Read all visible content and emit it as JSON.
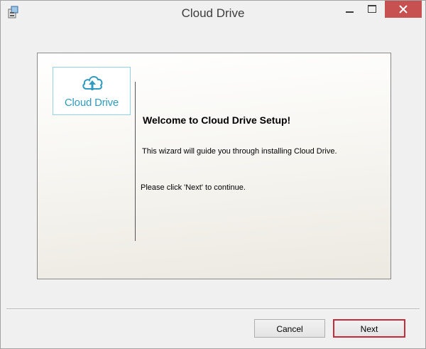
{
  "window": {
    "title": "Cloud Drive",
    "app_icon": "installer-icon"
  },
  "logo": {
    "icon": "cloud-upload-icon",
    "text": "Cloud Drive"
  },
  "wizard": {
    "heading": "Welcome to Cloud Drive Setup!",
    "description": "This wizard will guide you through installing Cloud Drive.",
    "instruction": "Please click 'Next' to continue."
  },
  "buttons": {
    "cancel_label": "Cancel",
    "next_label": "Next"
  },
  "colors": {
    "accent_close": "#c75050",
    "default_button_border": "#c42b3c",
    "logo_blue": "#2f9bc0"
  }
}
